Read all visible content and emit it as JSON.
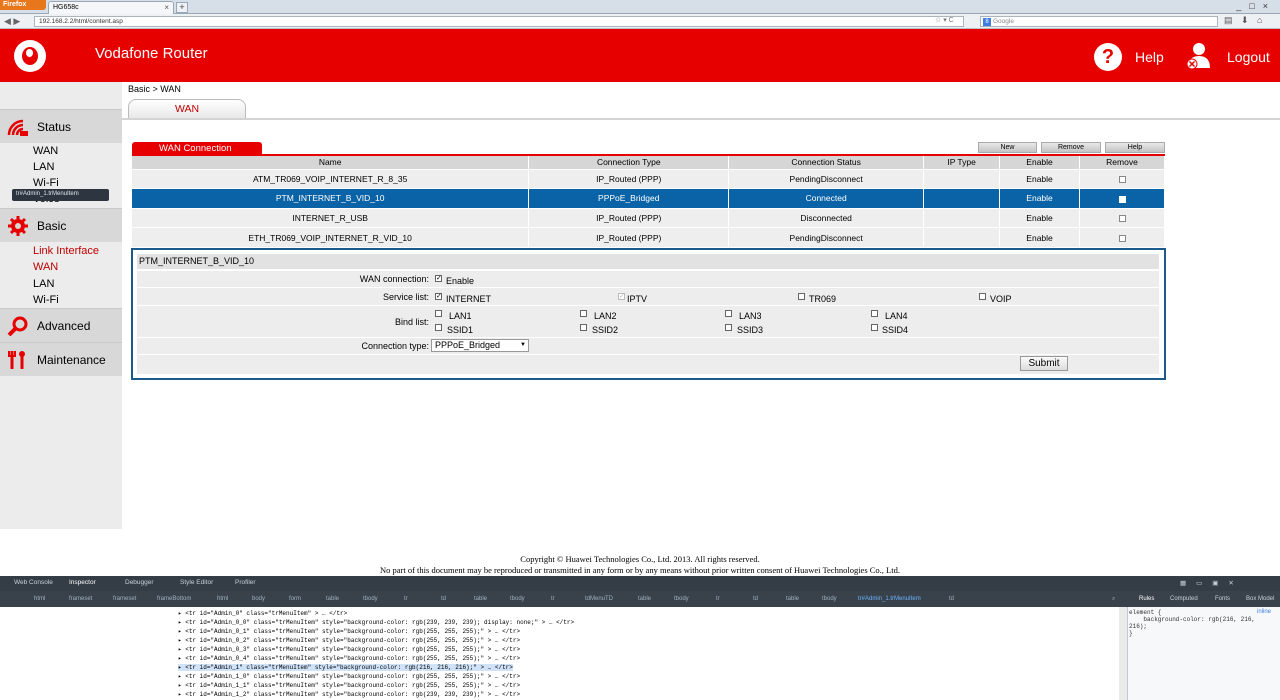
{
  "browser": {
    "app_button": "Firefox",
    "tab_title": "HG658c",
    "url": "192.168.2.2/html/content.asp",
    "search_placeholder": "Google"
  },
  "header": {
    "title": "Vodafone Router",
    "help_label": "Help",
    "logout_label": "Logout"
  },
  "sidebar": {
    "status": {
      "label": "Status",
      "items": [
        "WAN",
        "LAN",
        "Wi-Fi",
        "Voice"
      ]
    },
    "basic": {
      "label": "Basic",
      "items": [
        "Link Interface",
        "WAN",
        "LAN",
        "Wi-Fi"
      ]
    },
    "advanced": {
      "label": "Advanced"
    },
    "maintenance": {
      "label": "Maintenance"
    },
    "tooltip": "tr#Admin_1.trMenuItem"
  },
  "main": {
    "breadcrumb": "Basic > WAN",
    "tab_label": "WAN",
    "section_title": "WAN Connection",
    "buttons": {
      "new": "New",
      "remove": "Remove",
      "help": "Help"
    },
    "columns": [
      "Name",
      "Connection Type",
      "Connection Status",
      "IP Type",
      "Enable",
      "Remove"
    ],
    "rows": [
      {
        "name": "ATM_TR069_VOIP_INTERNET_R_8_35",
        "type": "IP_Routed (PPP)",
        "status": "PendingDisconnect",
        "ip": "",
        "enable": "Enable"
      },
      {
        "name": "PTM_INTERNET_B_VID_10",
        "type": "PPPoE_Bridged",
        "status": "Connected",
        "ip": "",
        "enable": "Enable"
      },
      {
        "name": "INTERNET_R_USB",
        "type": "IP_Routed (PPP)",
        "status": "Disconnected",
        "ip": "",
        "enable": "Enable"
      },
      {
        "name": "ETH_TR069_VOIP_INTERNET_R_VID_10",
        "type": "IP_Routed (PPP)",
        "status": "PendingDisconnect",
        "ip": "",
        "enable": "Enable"
      }
    ],
    "selected_row": 1
  },
  "detail": {
    "title": "PTM_INTERNET_B_VID_10",
    "wan_connection_label": "WAN connection:",
    "wan_enable": "Enable",
    "service_list_label": "Service list:",
    "services": [
      "INTERNET",
      "IPTV",
      "TR069",
      "VOIP"
    ],
    "bind_list_label": "Bind list:",
    "bind_row1": [
      "LAN1",
      "LAN2",
      "LAN3",
      "LAN4"
    ],
    "bind_row2": [
      "SSID1",
      "SSID2",
      "SSID3",
      "SSID4"
    ],
    "connection_type_label": "Connection type:",
    "connection_type_value": "PPPoE_Bridged",
    "submit": "Submit"
  },
  "footer": {
    "copyright": "Copyright © Huawei Technologies Co., Ltd. 2013. All rights reserved.",
    "notice": "No part of this document may be reproduced or transmitted in any form or by any means without prior written consent of Huawei Technologies Co., Ltd."
  },
  "devtools": {
    "tabs": [
      "Web Console",
      "Inspector",
      "Debugger",
      "Style Editor",
      "Profiler"
    ],
    "crumbs": [
      "html",
      "frameset",
      "frameset",
      "frameBottom",
      "html",
      "body",
      "form",
      "table",
      "tbody",
      "tr",
      "td",
      "table",
      "tbody",
      "tr",
      "tdMenuTD",
      "table",
      "tbody",
      "tr",
      "td",
      "table",
      "tbody",
      "tr#Admin_1.trMenuItem",
      "td"
    ],
    "side_tabs": [
      "Rules",
      "Computed",
      "Fonts",
      "Box Model"
    ],
    "code_lines": [
      "▸ <tr id=\"Admin_0\" class=\"trMenuItem\" > … </tr>",
      "▸ <tr id=\"Admin_0_0\" class=\"trMenuItem\" style=\"background-color: rgb(239, 239, 239); display: none;\" > … </tr>",
      "▸ <tr id=\"Admin_0_1\" class=\"trMenuItem\" style=\"background-color: rgb(255, 255, 255);\" > … </tr>",
      "▸ <tr id=\"Admin_0_2\" class=\"trMenuItem\" style=\"background-color: rgb(255, 255, 255);\" > … </tr>",
      "▸ <tr id=\"Admin_0_3\" class=\"trMenuItem\" style=\"background-color: rgb(255, 255, 255);\" > … </tr>",
      "▸ <tr id=\"Admin_0_4\" class=\"trMenuItem\" style=\"background-color: rgb(255, 255, 255);\" > … </tr>",
      "▸ <tr id=\"Admin_1\" class=\"trMenuItem\" style=\"background-color: rgb(216, 216, 216);\" > … </tr>",
      "▸ <tr id=\"Admin_1_0\" class=\"trMenuItem\" style=\"background-color: rgb(255, 255, 255);\" > … </tr>",
      "▸ <tr id=\"Admin_1_1\" class=\"trMenuItem\" style=\"background-color: rgb(255, 255, 255);\" > … </tr>",
      "▸ <tr id=\"Admin_1_2\" class=\"trMenuItem\" style=\"background-color: rgb(239, 239, 239);\" > … </tr>"
    ],
    "rules_text": "element {\n    background-color: rgb(216, 216,\n216);\n}",
    "rules_inline": "inline"
  },
  "colors": {
    "brand_red": "#e60000",
    "selected_row": "#0a63a6",
    "link_red": "#c00000"
  }
}
